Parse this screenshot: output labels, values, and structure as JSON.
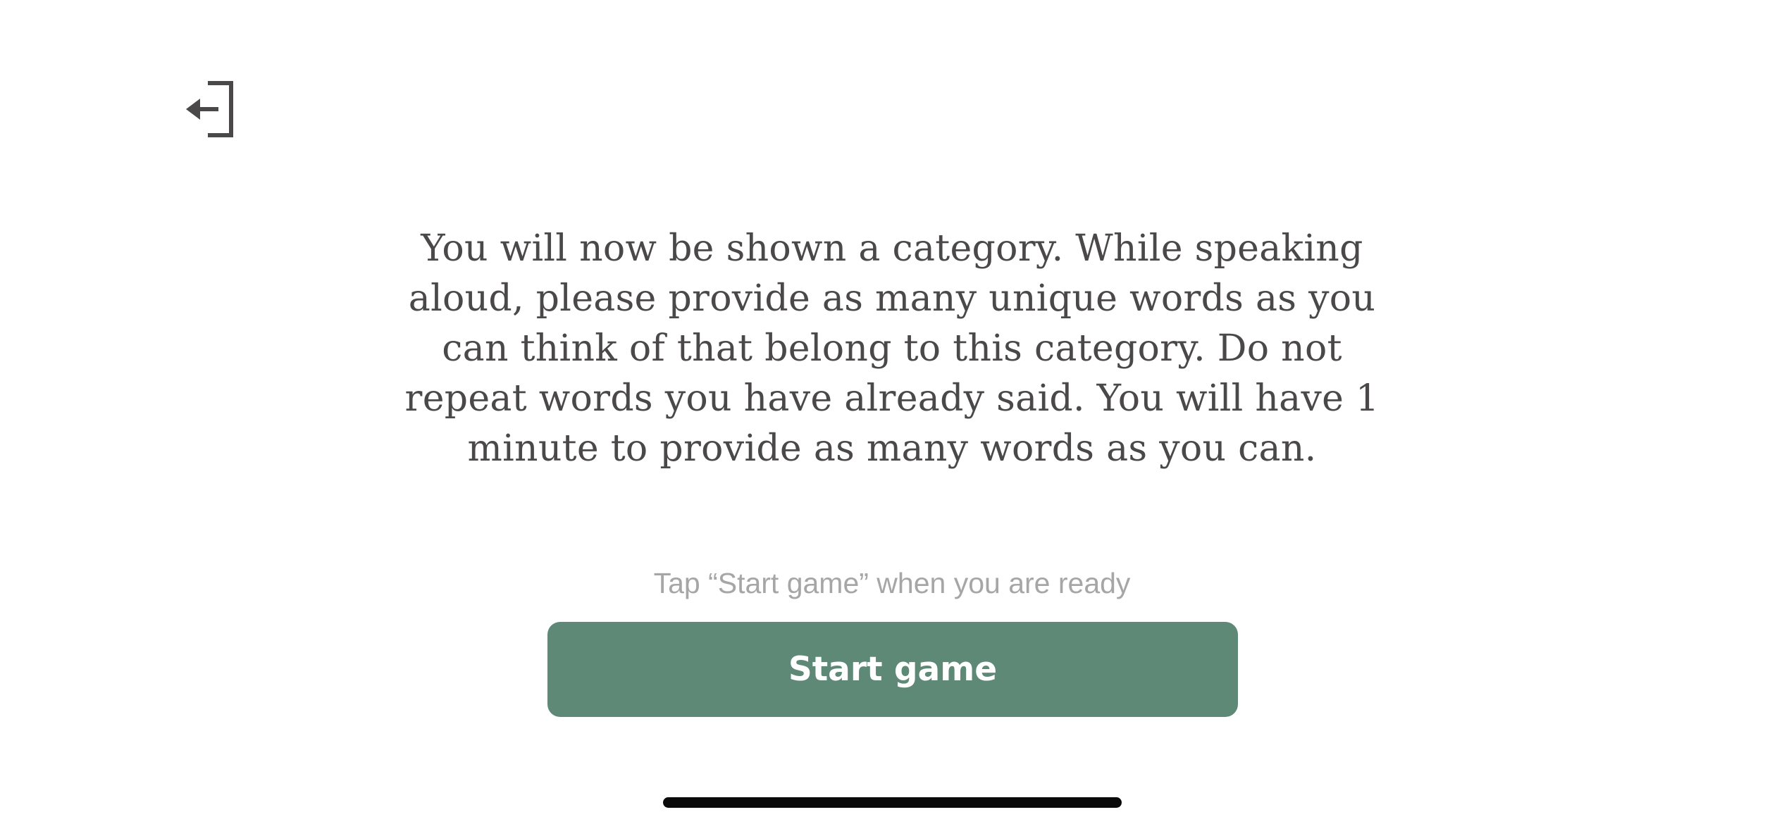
{
  "header": {
    "exit_icon": "exit-arrow-icon",
    "icon_color": "#4a4849"
  },
  "main": {
    "instructions": "You will now be shown a category. While speaking aloud, please provide as many unique words as you can think of that belong to this category. Do not repeat words you have already said. You will have 1 minute to provide as many words as you can.",
    "hint": "Tap “Start game” when you are ready",
    "start_label": "Start game"
  },
  "colors": {
    "accent": "#5f8977",
    "text": "#4a4849",
    "hint": "#a6a6a6"
  }
}
